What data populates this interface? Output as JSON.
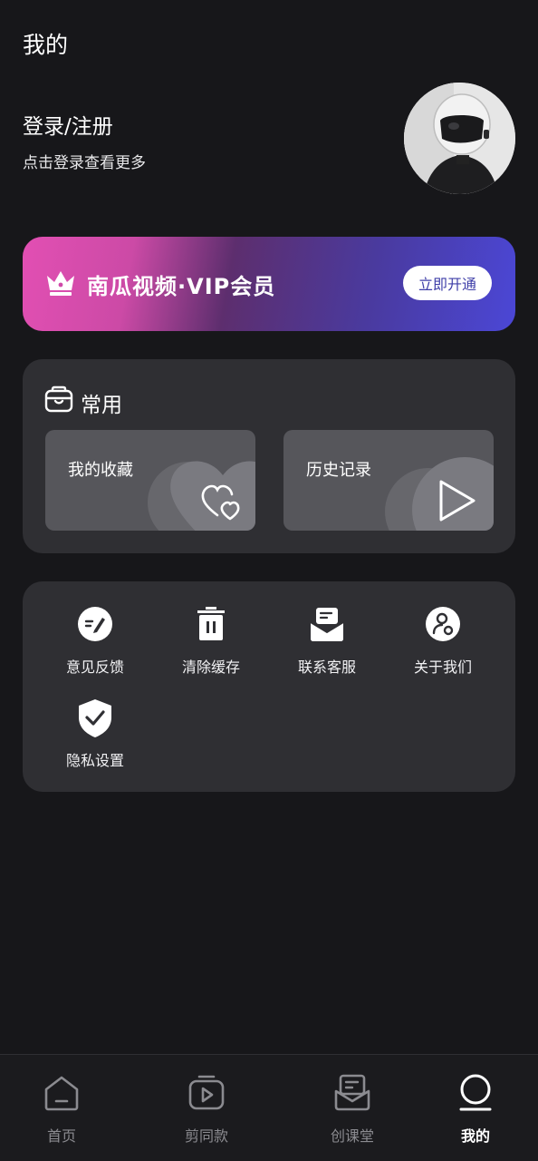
{
  "header": {
    "title": "我的"
  },
  "login": {
    "title": "登录/注册",
    "subtitle": "点击登录查看更多"
  },
  "vip": {
    "title": "南瓜视频·VIP会员",
    "button": "立即开通",
    "icon": "crown-icon"
  },
  "common": {
    "title": "常用",
    "tiles": [
      {
        "label": "我的收藏",
        "icon": "heart-icon"
      },
      {
        "label": "历史记录",
        "icon": "play-icon"
      }
    ]
  },
  "tools": [
    {
      "label": "意见反馈",
      "icon": "feedback-icon"
    },
    {
      "label": "清除缓存",
      "icon": "trash-icon"
    },
    {
      "label": "联系客服",
      "icon": "service-icon"
    },
    {
      "label": "关于我们",
      "icon": "about-icon"
    },
    {
      "label": "隐私设置",
      "icon": "shield-icon"
    }
  ],
  "nav": [
    {
      "label": "首页",
      "icon": "home-icon",
      "active": false
    },
    {
      "label": "剪同款",
      "icon": "video-template-icon",
      "active": false
    },
    {
      "label": "创课堂",
      "icon": "classroom-icon",
      "active": false
    },
    {
      "label": "我的",
      "icon": "profile-icon",
      "active": true
    }
  ]
}
